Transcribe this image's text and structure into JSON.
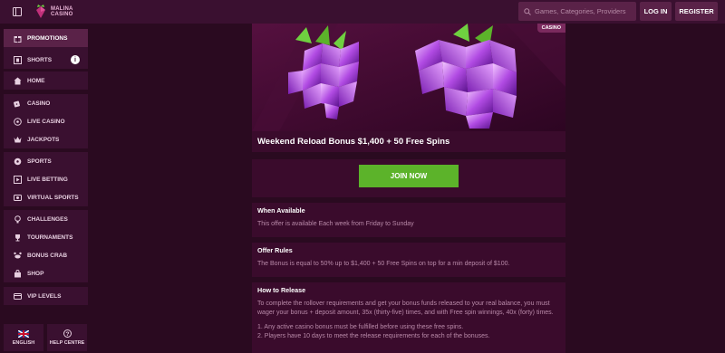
{
  "header": {
    "brand_line1": "MALINA",
    "brand_line2": "CASINO",
    "search_placeholder": "Games, Categories, Providers",
    "login_label": "LOG IN",
    "register_label": "REGISTER"
  },
  "sidebar": {
    "items": [
      {
        "label": "PROMOTIONS",
        "icon": "gift-icon"
      },
      {
        "label": "SHORTS",
        "icon": "film-icon"
      },
      {
        "label": "HOME",
        "icon": "home-icon"
      },
      {
        "label": "CASINO",
        "icon": "dice-icon"
      },
      {
        "label": "LIVE CASINO",
        "icon": "roulette-icon"
      },
      {
        "label": "JACKPOTS",
        "icon": "crown-icon"
      },
      {
        "label": "SPORTS",
        "icon": "ball-icon"
      },
      {
        "label": "LIVE BETTING",
        "icon": "play-icon"
      },
      {
        "label": "VIRTUAL SPORTS",
        "icon": "virtual-icon"
      },
      {
        "label": "CHALLENGES",
        "icon": "challenge-icon"
      },
      {
        "label": "TOURNAMENTS",
        "icon": "trophy-icon"
      },
      {
        "label": "BONUS CRAB",
        "icon": "crab-icon"
      },
      {
        "label": "SHOP",
        "icon": "shop-icon"
      },
      {
        "label": "VIP LEVELS",
        "icon": "vip-icon"
      }
    ],
    "language_label": "ENGLISH",
    "help_label": "HELP CENTRE"
  },
  "promo": {
    "tag": "CASINO",
    "title": "Weekend Reload Bonus $1,400 + 50 Free Spins",
    "join_label": "JOIN NOW",
    "sections": [
      {
        "heading": "When Available",
        "body": "This offer is available Each week from Friday to Sunday"
      },
      {
        "heading": "Offer Rules",
        "body": "The Bonus is equal to 50% up to $1,400 + 50 Free Spins on top for a min deposit of $100."
      },
      {
        "heading": "How to Release",
        "body": "To complete the rollover requirements and get your bonus funds released to your real balance, you must wager your bonus + deposit amount, 35x (thirty-five) times, and with Free spin winnings, 40x (forty) times."
      }
    ],
    "rules": [
      "1. Any active casino bonus must be fulfilled before using these free spins.",
      "2. Players have 10 days to meet the release requirements for each of the bonuses."
    ]
  },
  "colors": {
    "background": "#2a0a20",
    "panel": "#3a0b2c",
    "accent_green": "#5cb32a",
    "muted_text": "#b98aa9"
  }
}
